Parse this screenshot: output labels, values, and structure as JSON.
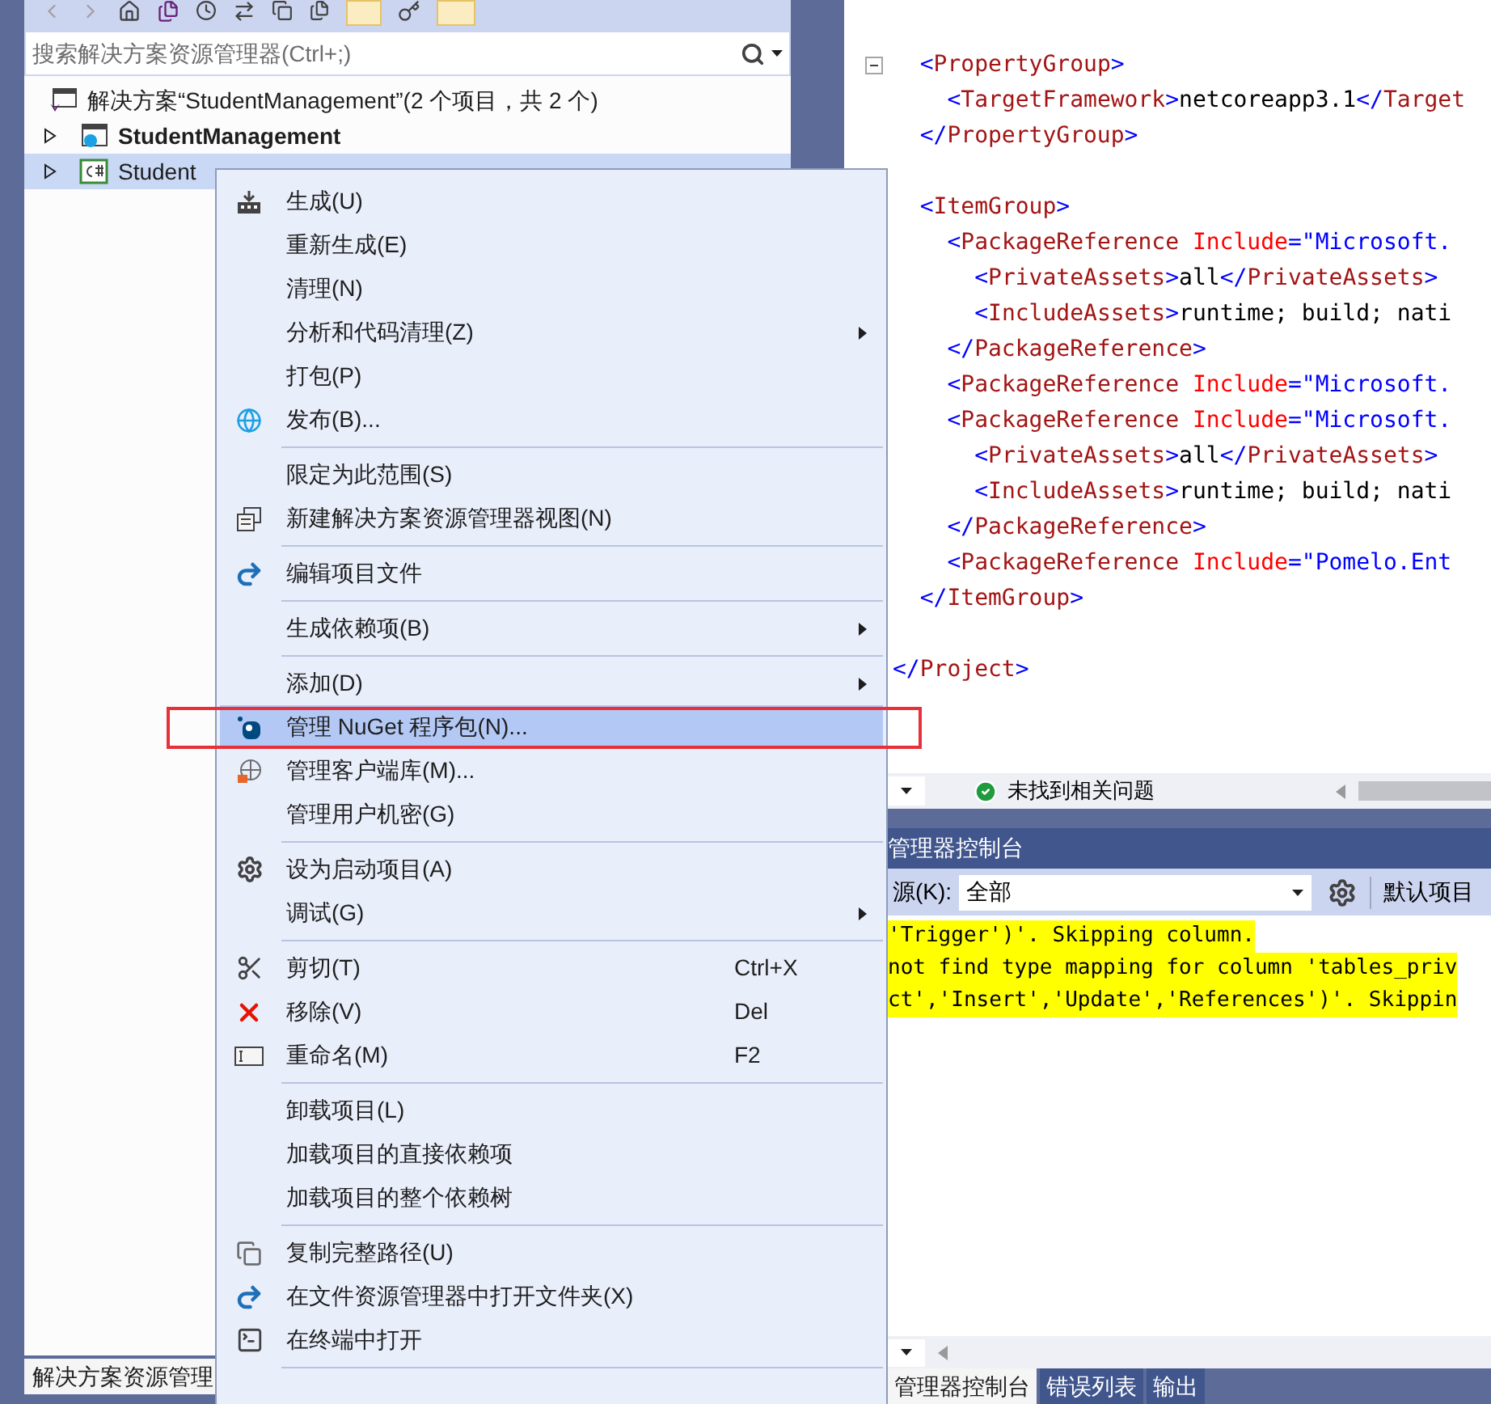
{
  "solution_explorer": {
    "search": {
      "placeholder": "搜索解决方案资源管理器(Ctrl+;)"
    },
    "tree": [
      {
        "label": "解决方案“StudentManagement”(2 个项目，共 2 个)",
        "selected": false,
        "children": [
          {
            "label": "StudentManagement",
            "startup_project": true,
            "expanded": false,
            "selected": false
          },
          {
            "label": "Student",
            "startup_project": false,
            "expanded": false,
            "selected": true
          }
        ]
      }
    ],
    "bottom_tab": {
      "label": "解决方案资源管理",
      "selected": true
    }
  },
  "editor": {
    "lines": [
      {
        "kind": "code",
        "expanded": true,
        "segments": [
          {
            "kind": "bracket",
            "text": "  <"
          },
          {
            "kind": "tag",
            "text": "PropertyGroup"
          },
          {
            "kind": "bracket",
            "text": ">"
          }
        ]
      },
      {
        "kind": "code",
        "segments": [
          {
            "kind": "bracket",
            "text": "    <"
          },
          {
            "kind": "tag",
            "text": "TargetFramework"
          },
          {
            "kind": "bracket",
            "text": ">"
          },
          {
            "kind": "text",
            "text": "netcoreapp3.1"
          },
          {
            "kind": "bracket",
            "text": "</"
          },
          {
            "kind": "tag",
            "text": "Target"
          }
        ]
      },
      {
        "kind": "code",
        "segments": [
          {
            "kind": "bracket",
            "text": "  </"
          },
          {
            "kind": "tag",
            "text": "PropertyGroup"
          },
          {
            "kind": "bracket",
            "text": ">"
          }
        ]
      },
      {
        "kind": "blank"
      },
      {
        "kind": "code",
        "segments": [
          {
            "kind": "bracket",
            "text": "  <"
          },
          {
            "kind": "tag",
            "text": "ItemGroup"
          },
          {
            "kind": "bracket",
            "text": ">"
          }
        ]
      },
      {
        "kind": "code",
        "segments": [
          {
            "kind": "bracket",
            "text": "    <"
          },
          {
            "kind": "tag",
            "text": "PackageReference"
          },
          {
            "kind": "attribute",
            "text": " Include"
          },
          {
            "kind": "bracket",
            "text": "=\""
          },
          {
            "kind": "value",
            "text": "Microsoft."
          }
        ]
      },
      {
        "kind": "code",
        "segments": [
          {
            "kind": "bracket",
            "text": "      <"
          },
          {
            "kind": "tag",
            "text": "PrivateAssets"
          },
          {
            "kind": "bracket",
            "text": ">"
          },
          {
            "kind": "text",
            "text": "all"
          },
          {
            "kind": "bracket",
            "text": "</"
          },
          {
            "kind": "tag",
            "text": "PrivateAssets"
          },
          {
            "kind": "bracket",
            "text": ">"
          }
        ]
      },
      {
        "kind": "code",
        "segments": [
          {
            "kind": "bracket",
            "text": "      <"
          },
          {
            "kind": "tag",
            "text": "IncludeAssets"
          },
          {
            "kind": "bracket",
            "text": ">"
          },
          {
            "kind": "text",
            "text": "runtime; build; nati"
          }
        ]
      },
      {
        "kind": "code",
        "segments": [
          {
            "kind": "bracket",
            "text": "    </"
          },
          {
            "kind": "tag",
            "text": "PackageReference"
          },
          {
            "kind": "bracket",
            "text": ">"
          }
        ]
      },
      {
        "kind": "code",
        "segments": [
          {
            "kind": "bracket",
            "text": "    <"
          },
          {
            "kind": "tag",
            "text": "PackageReference"
          },
          {
            "kind": "attribute",
            "text": " Include"
          },
          {
            "kind": "bracket",
            "text": "=\""
          },
          {
            "kind": "value",
            "text": "Microsoft."
          }
        ]
      },
      {
        "kind": "code",
        "segments": [
          {
            "kind": "bracket",
            "text": "    <"
          },
          {
            "kind": "tag",
            "text": "PackageReference"
          },
          {
            "kind": "attribute",
            "text": " Include"
          },
          {
            "kind": "bracket",
            "text": "=\""
          },
          {
            "kind": "value",
            "text": "Microsoft."
          }
        ]
      },
      {
        "kind": "code",
        "segments": [
          {
            "kind": "bracket",
            "text": "      <"
          },
          {
            "kind": "tag",
            "text": "PrivateAssets"
          },
          {
            "kind": "bracket",
            "text": ">"
          },
          {
            "kind": "text",
            "text": "all"
          },
          {
            "kind": "bracket",
            "text": "</"
          },
          {
            "kind": "tag",
            "text": "PrivateAssets"
          },
          {
            "kind": "bracket",
            "text": ">"
          }
        ]
      },
      {
        "kind": "code",
        "segments": [
          {
            "kind": "bracket",
            "text": "      <"
          },
          {
            "kind": "tag",
            "text": "IncludeAssets"
          },
          {
            "kind": "bracket",
            "text": ">"
          },
          {
            "kind": "text",
            "text": "runtime; build; nati"
          }
        ]
      },
      {
        "kind": "code",
        "segments": [
          {
            "kind": "bracket",
            "text": "    </"
          },
          {
            "kind": "tag",
            "text": "PackageReference"
          },
          {
            "kind": "bracket",
            "text": ">"
          }
        ]
      },
      {
        "kind": "code",
        "segments": [
          {
            "kind": "bracket",
            "text": "    <"
          },
          {
            "kind": "tag",
            "text": "PackageReference"
          },
          {
            "kind": "attribute",
            "text": " Include"
          },
          {
            "kind": "bracket",
            "text": "=\""
          },
          {
            "kind": "value",
            "text": "Pomelo.Ent"
          }
        ]
      },
      {
        "kind": "code",
        "segments": [
          {
            "kind": "bracket",
            "text": "  </"
          },
          {
            "kind": "tag",
            "text": "ItemGroup"
          },
          {
            "kind": "bracket",
            "text": ">"
          }
        ]
      },
      {
        "kind": "blank"
      },
      {
        "kind": "code",
        "segments": [
          {
            "kind": "bracket",
            "text": "</"
          },
          {
            "kind": "tag",
            "text": "Project"
          },
          {
            "kind": "bracket",
            "text": ">"
          }
        ]
      }
    ],
    "status": "未找到相关问题"
  },
  "console": {
    "title": "管理器控制台",
    "source_label": "源(K):",
    "source_value": "全部",
    "default_project_label": "默认项目",
    "output": [
      "'Trigger')'. Skipping column.",
      "not find type mapping for column 'tables_priv",
      "ct','Insert','Update','References')'. Skippin"
    ]
  },
  "bottom_tabs": [
    {
      "label": "管理器控制台",
      "selected": true
    },
    {
      "label": "错误列表",
      "selected": false
    },
    {
      "label": "输出",
      "selected": false
    }
  ],
  "context_menu": {
    "items": [
      {
        "kind": "item",
        "label": "生成(U)",
        "submenu": false,
        "selected": false
      },
      {
        "kind": "item",
        "label": "重新生成(E)",
        "submenu": false,
        "selected": false
      },
      {
        "kind": "item",
        "label": "清理(N)",
        "submenu": false,
        "selected": false
      },
      {
        "kind": "item",
        "label": "分析和代码清理(Z)",
        "submenu": true,
        "selected": false
      },
      {
        "kind": "item",
        "label": "打包(P)",
        "submenu": false,
        "selected": false
      },
      {
        "kind": "item",
        "label": "发布(B)...",
        "submenu": false,
        "selected": false
      },
      {
        "kind": "separator"
      },
      {
        "kind": "item",
        "label": "限定为此范围(S)",
        "submenu": false,
        "selected": false
      },
      {
        "kind": "item",
        "label": "新建解决方案资源管理器视图(N)",
        "submenu": false,
        "selected": false
      },
      {
        "kind": "separator"
      },
      {
        "kind": "item",
        "label": "编辑项目文件",
        "submenu": false,
        "selected": false
      },
      {
        "kind": "separator"
      },
      {
        "kind": "item",
        "label": "生成依赖项(B)",
        "submenu": true,
        "selected": false
      },
      {
        "kind": "separator"
      },
      {
        "kind": "item",
        "label": "添加(D)",
        "submenu": true,
        "selected": false
      },
      {
        "kind": "item",
        "label": "管理 NuGet 程序包(N)...",
        "submenu": false,
        "selected": true,
        "annotated": true
      },
      {
        "kind": "item",
        "label": "管理客户端库(M)...",
        "submenu": false,
        "selected": false
      },
      {
        "kind": "item",
        "label": "管理用户机密(G)",
        "submenu": false,
        "selected": false
      },
      {
        "kind": "separator"
      },
      {
        "kind": "item",
        "label": "设为启动项目(A)",
        "submenu": false,
        "selected": false
      },
      {
        "kind": "item",
        "label": "调试(G)",
        "submenu": true,
        "selected": false
      },
      {
        "kind": "separator"
      },
      {
        "kind": "item",
        "label": "剪切(T)",
        "shortcut": "Ctrl+X",
        "submenu": false,
        "selected": false
      },
      {
        "kind": "item",
        "label": "移除(V)",
        "shortcut": "Del",
        "submenu": false,
        "selected": false
      },
      {
        "kind": "item",
        "label": "重命名(M)",
        "shortcut": "F2",
        "submenu": false,
        "selected": false
      },
      {
        "kind": "separator"
      },
      {
        "kind": "item",
        "label": "卸载项目(L)",
        "submenu": false,
        "selected": false
      },
      {
        "kind": "item",
        "label": "加载项目的直接依赖项",
        "submenu": false,
        "selected": false
      },
      {
        "kind": "item",
        "label": "加载项目的整个依赖树",
        "submenu": false,
        "selected": false
      },
      {
        "kind": "separator"
      },
      {
        "kind": "item",
        "label": "复制完整路径(U)",
        "submenu": false,
        "selected": false
      },
      {
        "kind": "item",
        "label": "在文件资源管理器中打开文件夹(X)",
        "submenu": false,
        "selected": false
      },
      {
        "kind": "item",
        "label": "在终端中打开",
        "submenu": false,
        "selected": false
      },
      {
        "kind": "separator"
      }
    ]
  }
}
